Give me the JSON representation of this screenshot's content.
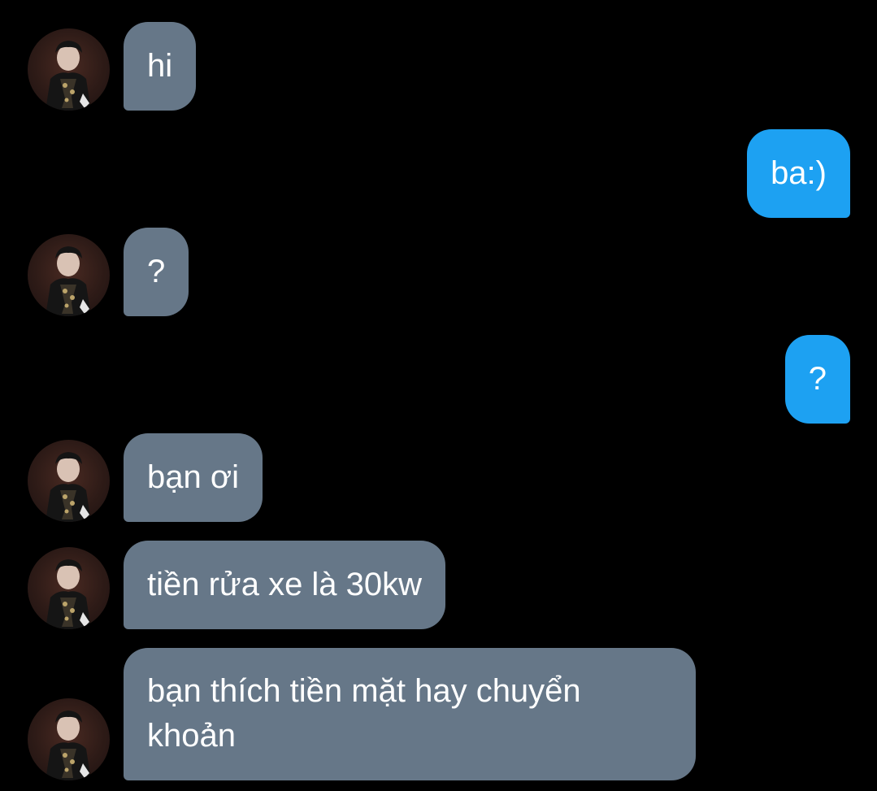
{
  "conversation": {
    "messages": [
      {
        "side": "in",
        "text": "hi"
      },
      {
        "side": "out",
        "text": "ba:)"
      },
      {
        "side": "in",
        "text": "?"
      },
      {
        "side": "out",
        "text": "?"
      },
      {
        "side": "in",
        "text": "bạn ơi"
      },
      {
        "side": "in",
        "text": "tiền rửa xe là 30kw"
      },
      {
        "side": "in",
        "text": "bạn thích tiền mặt hay chuyển khoản"
      }
    ]
  },
  "colors": {
    "background": "#000000",
    "incoming_bubble": "#667788",
    "outgoing_bubble": "#1da1f2",
    "text": "#ffffff"
  },
  "icons": {
    "avatar": "contact-avatar-photo"
  }
}
